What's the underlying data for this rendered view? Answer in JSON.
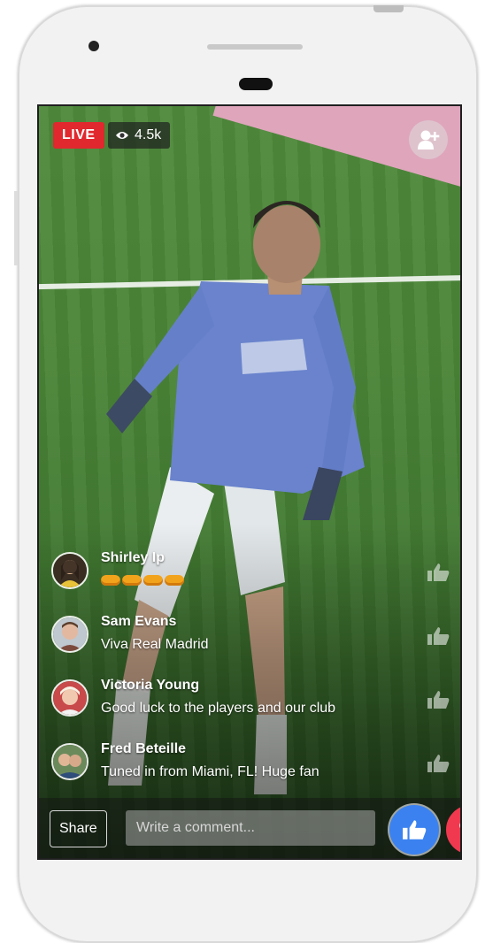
{
  "live": {
    "badge": "LIVE",
    "viewers": "4.5k"
  },
  "comments": [
    {
      "name": "Shirley Ip",
      "text": "",
      "emoji_count": 4
    },
    {
      "name": "Sam Evans",
      "text": "Viva Real Madrid"
    },
    {
      "name": "Victoria Young",
      "text": "Good luck to the players and our club"
    },
    {
      "name": "Fred Beteille",
      "text": "Tuned in from Miami, FL! Huge fan"
    }
  ],
  "composer": {
    "share_label": "Share",
    "placeholder": "Write a comment..."
  },
  "colors": {
    "live_red": "#e0282e",
    "like_blue": "#3b82f0",
    "love_red": "#f0394f",
    "pitch_green": "#4a8437",
    "pitch_pink": "#e7a7c2"
  },
  "icons": [
    "eye-icon",
    "add-friend-icon",
    "like-icon",
    "love-icon"
  ]
}
